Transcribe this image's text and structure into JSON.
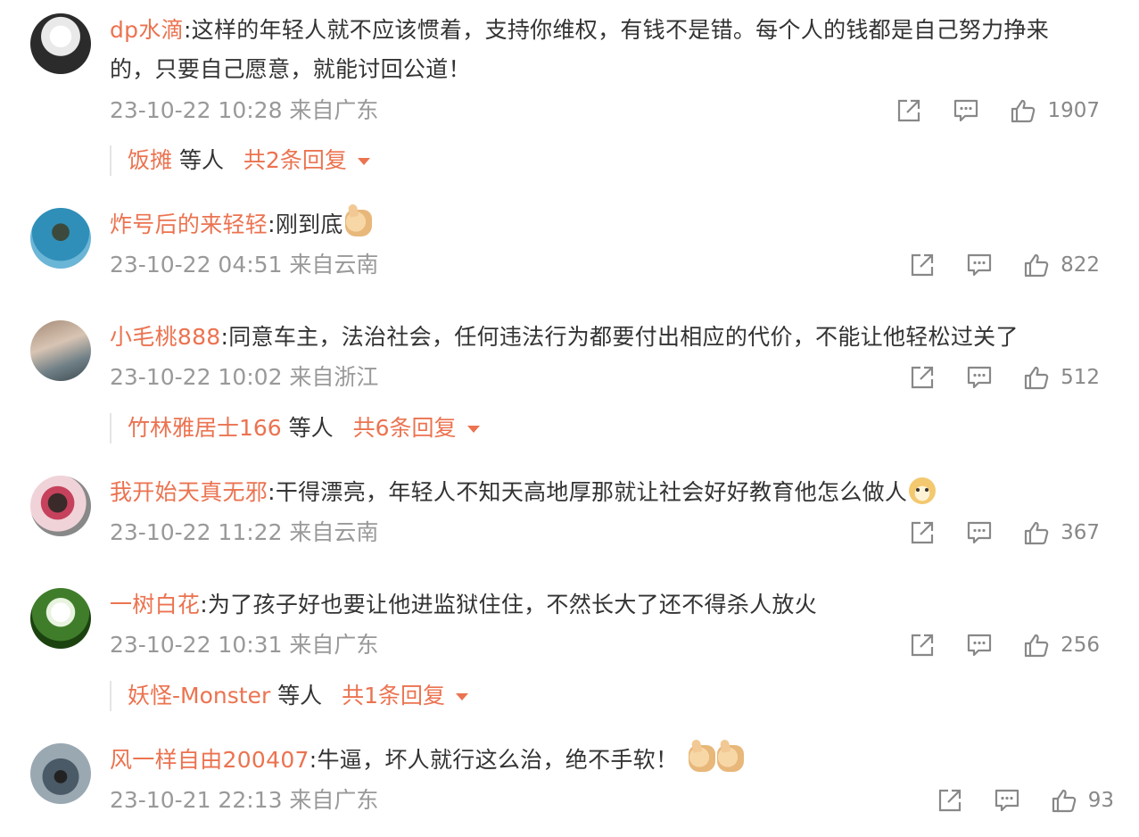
{
  "comments": [
    {
      "user": "dp水滴",
      "text_lines": [
        ":这样的年轻人就不应该惯着，支持你维权，有钱不是错。每个人的钱都是自己努力挣来",
        "的，只要自己愿意，就能讨回公道！"
      ],
      "time": "23-10-22 10:28 来自广东",
      "likes": "1907",
      "reply_user": "饭摊",
      "reply_mid": " 等人 ",
      "reply_total": "共2条回复"
    },
    {
      "user": "炸号后的来轻轻",
      "text": ":刚到底",
      "time": "23-10-22 04:51 来自云南",
      "likes": "822"
    },
    {
      "user": "小毛桃888",
      "text": ":同意车主，法治社会，任何违法行为都要付出相应的代价，不能让他轻松过关了",
      "time": "23-10-22 10:02 来自浙江",
      "likes": "512",
      "reply_user": "竹林雅居士166",
      "reply_mid": " 等人 ",
      "reply_total": "共6条回复"
    },
    {
      "user": "我开始天真无邪",
      "text": ":干得漂亮，年轻人不知天高地厚那就让社会好好教育他怎么做人",
      "time": "23-10-22 11:22 来自云南",
      "likes": "367"
    },
    {
      "user": "一树白花",
      "text": ":为了孩子好也要让他进监狱住住，不然长大了还不得杀人放火",
      "time": "23-10-22 10:31 来自广东",
      "likes": "256",
      "reply_user": "妖怪-Monster",
      "reply_mid": " 等人 ",
      "reply_total": "共1条回复"
    },
    {
      "user": "风一样自由200407",
      "text": ":牛逼，坏人就行这么治，绝不手软！",
      "time": "23-10-21 22:13 来自广东",
      "likes": "93"
    }
  ],
  "colors": {
    "username": "#eb7350",
    "meta": "#999999",
    "text": "#333333"
  },
  "icons": {
    "share": "share-icon",
    "comment": "comment-icon",
    "like": "like-icon"
  }
}
